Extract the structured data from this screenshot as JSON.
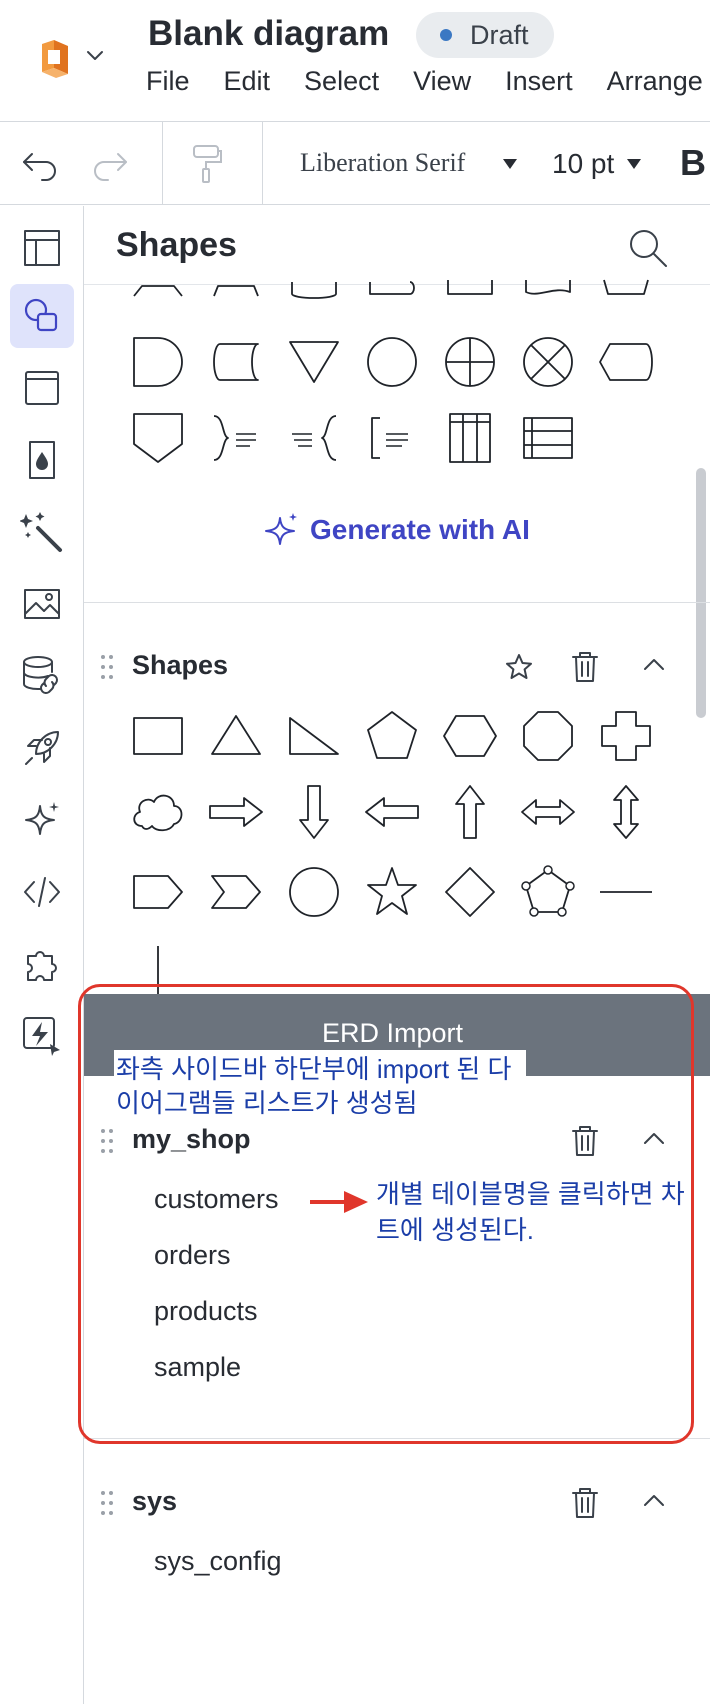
{
  "header": {
    "doc_title": "Blank diagram",
    "status_badge": "Draft",
    "menu": [
      "File",
      "Edit",
      "Select",
      "View",
      "Insert",
      "Arrange"
    ]
  },
  "toolbar": {
    "font_family": "Liberation Serif",
    "font_size": "10 pt",
    "bold": "B"
  },
  "left_rail": {
    "items": [
      "templates-icon",
      "shapes-icon",
      "frame-icon",
      "fill-icon",
      "magic-wand-icon",
      "image-icon",
      "data-link-icon",
      "rocket-icon",
      "sparkle-icon",
      "code-icon",
      "puzzle-icon",
      "flash-import-icon"
    ],
    "active": "shapes-icon"
  },
  "panel": {
    "title": "Shapes",
    "generate_ai": "Generate with AI",
    "sections": [
      {
        "name": "Shapes"
      },
      {
        "name": "my_shop",
        "tables": [
          "customers",
          "orders",
          "products",
          "sample"
        ]
      },
      {
        "name": "sys",
        "tables": [
          "sys_config"
        ]
      }
    ],
    "erd_import_title": "ERD Import"
  },
  "annotations": {
    "note1": "좌측 사이드바 하단부에 import 된 다이어그램들 리스트가 생성됨",
    "note2": "개별 테이블명을 클릭하면 차트에 생성된다.",
    "highlight_color": "#e0362b",
    "note_color": "#1b3ea8"
  }
}
